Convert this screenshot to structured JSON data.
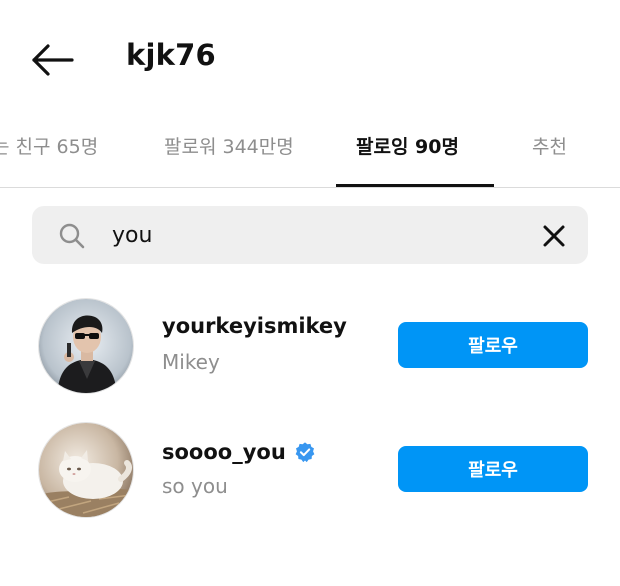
{
  "header": {
    "title": "kjk76"
  },
  "tabs": [
    {
      "label": "는 친구 65명",
      "active": false
    },
    {
      "label": "팔로워 344만명",
      "active": false
    },
    {
      "label": "팔로잉 90명",
      "active": true
    },
    {
      "label": "추천",
      "active": false
    }
  ],
  "search": {
    "value": "you",
    "icon": "search-icon",
    "clear_icon": "close-icon"
  },
  "users": [
    {
      "username": "yourkeyismikey",
      "full_name": "Mikey",
      "verified": false,
      "button_label": "팔로우"
    },
    {
      "username": "soooo_you",
      "full_name": "so you",
      "verified": true,
      "button_label": "팔로우"
    }
  ],
  "colors": {
    "accent": "#0095f6",
    "verified": "#3897f0",
    "muted_text": "#8e8e8e",
    "search_bg": "#efefef"
  }
}
